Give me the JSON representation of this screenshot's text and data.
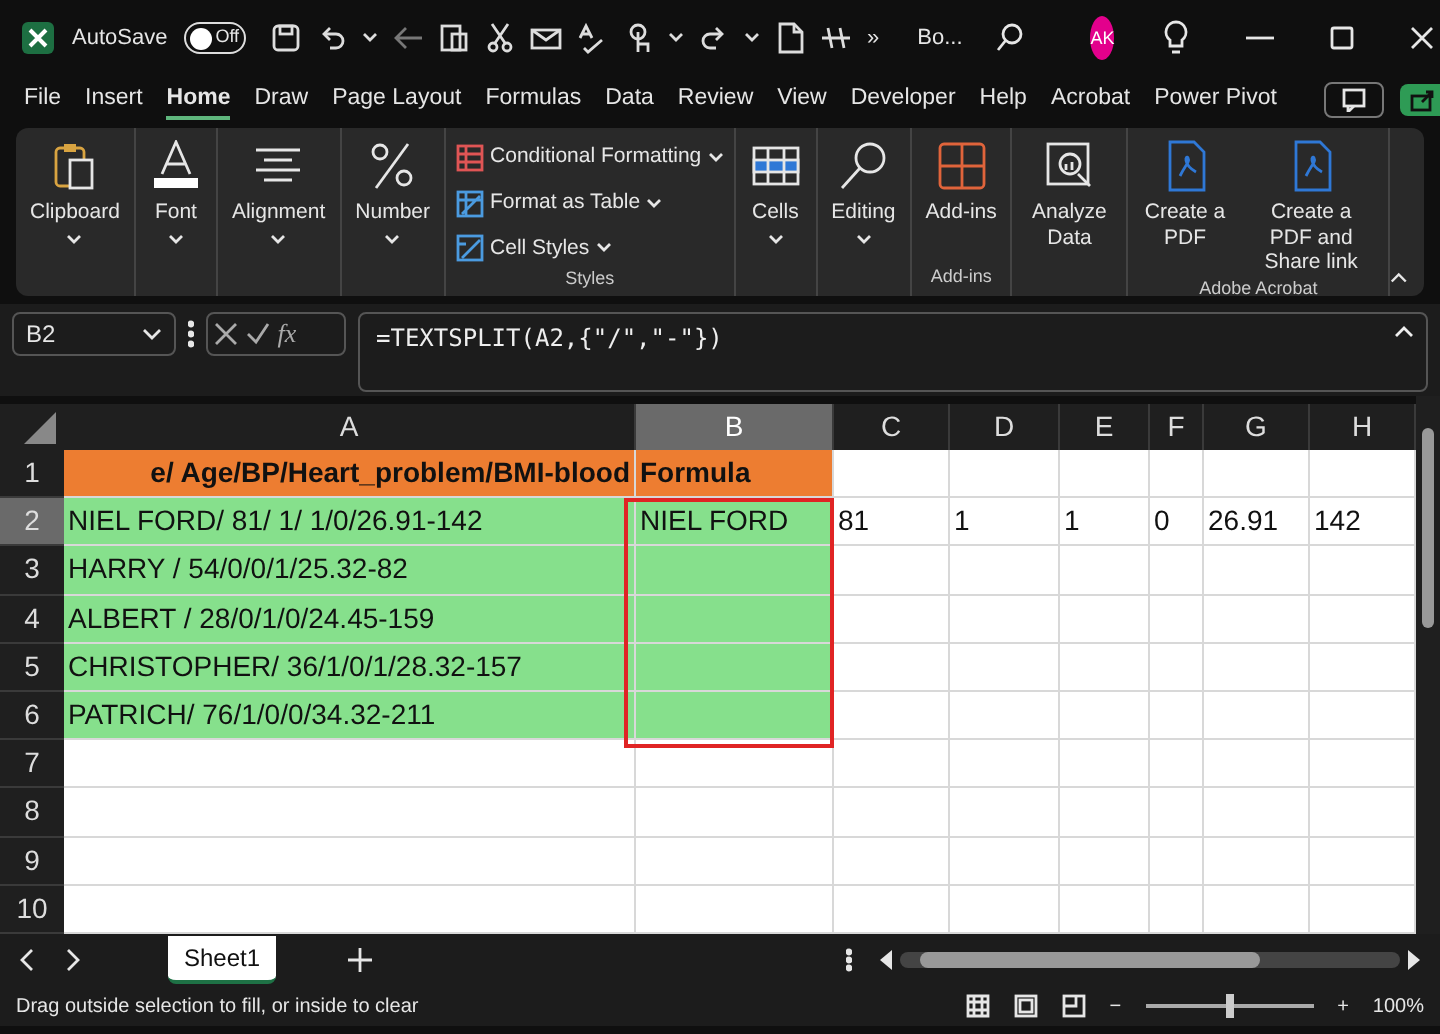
{
  "title_bar": {
    "autosave_label": "AutoSave",
    "autosave": {
      "on": false,
      "label": "Off"
    },
    "quick_access": [
      {
        "kind": "save"
      },
      {
        "kind": "undo"
      },
      {
        "kind": "caret"
      },
      {
        "kind": "back"
      },
      {
        "kind": "copy"
      },
      {
        "kind": "cut"
      },
      {
        "kind": "mail"
      },
      {
        "kind": "spell"
      },
      {
        "kind": "touch"
      },
      {
        "kind": "caret"
      },
      {
        "kind": "redo"
      },
      {
        "kind": "caret"
      },
      {
        "kind": "page"
      },
      {
        "kind": "strike"
      }
    ],
    "overflow": "»",
    "title": "Bo...",
    "avatar": "AK"
  },
  "menu_tabs": [
    {
      "label": "File",
      "selected": false
    },
    {
      "label": "Insert",
      "selected": false
    },
    {
      "label": "Home",
      "selected": true
    },
    {
      "label": "Draw",
      "selected": false
    },
    {
      "label": "Page Layout",
      "selected": false
    },
    {
      "label": "Formulas",
      "selected": false
    },
    {
      "label": "Data",
      "selected": false
    },
    {
      "label": "Review",
      "selected": false
    },
    {
      "label": "View",
      "selected": false
    },
    {
      "label": "Developer",
      "selected": false
    },
    {
      "label": "Help",
      "selected": false
    },
    {
      "label": "Acrobat",
      "selected": false
    },
    {
      "label": "Power Pivot",
      "selected": false
    }
  ],
  "ribbon": [
    {
      "items": [
        {
          "kind": "clipboard",
          "label": "Clipboard",
          "caret": true
        }
      ]
    },
    {
      "items": [
        {
          "kind": "font",
          "label": "Font",
          "caret": true
        }
      ]
    },
    {
      "items": [
        {
          "kind": "alignment",
          "label": "Alignment",
          "caret": true
        }
      ]
    },
    {
      "items": [
        {
          "kind": "number",
          "label": "Number",
          "caret": true
        }
      ]
    },
    {
      "name": "Styles",
      "stack": [
        {
          "kind": "conditional",
          "label": "Conditional Formatting"
        },
        {
          "kind": "table",
          "label": "Format as Table"
        },
        {
          "kind": "styles",
          "label": "Cell Styles"
        }
      ]
    },
    {
      "items": [
        {
          "kind": "cells",
          "label": "Cells",
          "caret": true
        }
      ]
    },
    {
      "items": [
        {
          "kind": "editing",
          "label": "Editing",
          "caret": true
        }
      ]
    },
    {
      "name": "Add-ins",
      "items": [
        {
          "kind": "addins",
          "label": "Add-ins",
          "caret": false
        }
      ]
    },
    {
      "items": [
        {
          "kind": "analyze",
          "label": "Analyze Data",
          "caret": false
        }
      ]
    },
    {
      "name": "Adobe Acrobat",
      "items": [
        {
          "kind": "pdf",
          "label": "Create a PDF",
          "caret": false
        },
        {
          "kind": "pdf",
          "label": "Create a PDF and Share link",
          "caret": false
        }
      ]
    }
  ],
  "formula_bar": {
    "name_box": "B2",
    "fx": "fx",
    "formula": "=TEXTSPLIT(A2,{\"/\",\"-\"})"
  },
  "columns": [
    {
      "label": "A",
      "selected": false
    },
    {
      "label": "B",
      "selected": true
    },
    {
      "label": "C",
      "selected": false
    },
    {
      "label": "D",
      "selected": false
    },
    {
      "label": "E",
      "selected": false
    },
    {
      "label": "F",
      "selected": false
    },
    {
      "label": "G",
      "selected": false
    },
    {
      "label": "H",
      "selected": false
    }
  ],
  "rows": [
    {
      "number": "1",
      "kind": "header",
      "selected": false,
      "cells": [
        {
          "text": "e/ Age/BP/Heart_problem/BMI-blood",
          "color": "#ed7d31"
        },
        {
          "text": "Formula",
          "color": "#ed7d31"
        }
      ]
    },
    {
      "number": "2",
      "kind": "data",
      "selected": true,
      "cells": [
        {
          "text": "NIEL FORD/ 81/ 1/ 1/0/26.91-142",
          "color": "#86e08c"
        },
        {
          "text": "NIEL FORD",
          "color": "#86e08c",
          "outlined": true
        },
        {
          "text": "81"
        },
        {
          "text": "1"
        },
        {
          "text": "1"
        },
        {
          "text": "0"
        },
        {
          "text": "26.91"
        },
        {
          "text": "142"
        }
      ]
    },
    {
      "number": "3",
      "kind": "data",
      "selected": false,
      "cells": [
        {
          "text": "HARRY / 54/0/0/1/25.32-82",
          "color": "#86e08c"
        },
        {
          "color": "#86e08c",
          "outlined": true
        }
      ]
    },
    {
      "number": "4",
      "kind": "data",
      "selected": false,
      "cells": [
        {
          "text": "ALBERT / 28/0/1/0/24.45-159",
          "color": "#86e08c"
        },
        {
          "color": "#86e08c",
          "outlined": true
        }
      ]
    },
    {
      "number": "5",
      "kind": "data",
      "selected": false,
      "cells": [
        {
          "text": "CHRISTOPHER/ 36/1/0/1/28.32-157",
          "color": "#86e08c"
        },
        {
          "color": "#86e08c",
          "outlined": true
        }
      ]
    },
    {
      "number": "6",
      "kind": "data",
      "selected": false,
      "cells": [
        {
          "text": "PATRICH/ 76/1/0/0/34.32-211",
          "color": "#86e08c"
        },
        {
          "color": "#86e08c",
          "outlined": true
        }
      ]
    },
    {
      "number": "7",
      "kind": "data",
      "selected": false,
      "cells": []
    },
    {
      "number": "8",
      "kind": "data",
      "selected": false,
      "cells": []
    },
    {
      "number": "9",
      "kind": "data",
      "selected": false,
      "cells": []
    },
    {
      "number": "10",
      "kind": "data",
      "selected": false,
      "cells": []
    }
  ],
  "sheet_tabs": [
    {
      "label": "Sheet1",
      "selected": true
    }
  ],
  "status_bar": {
    "message": "Drag outside selection to fill, or inside to clear",
    "zoom_out": "−",
    "zoom_slider": {
      "level": 0.5
    },
    "zoom_in": "+",
    "zoom": "100%"
  }
}
